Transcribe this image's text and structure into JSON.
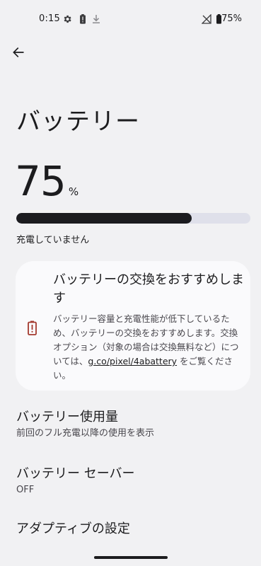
{
  "status_bar": {
    "time": "0:15",
    "battery_percent": "75%",
    "icons": [
      "gear-icon",
      "battery-alert-icon",
      "download-icon",
      "no-signal-icon",
      "battery-icon"
    ]
  },
  "header": {
    "back_icon": "arrow-back-icon",
    "title": "バッテリー"
  },
  "battery": {
    "level_value": "75",
    "level_unit": "%",
    "level_fraction": 0.75,
    "charging_status": "充電していません"
  },
  "warning_card": {
    "icon": "battery-alert-icon",
    "icon_color": "#a3392e",
    "title": "バッテリーの交換をおすすめします",
    "body_prefix": "バッテリー容量と充電性能が低下しているため、バッテリーの交換をおすすめします。交換オプション（対象の場合は交換無料など）については、",
    "link_text": "g.co/pixel/4abattery",
    "body_suffix": " をご覧ください。"
  },
  "settings": [
    {
      "title": "バッテリー使用量",
      "subtitle": "前回のフル充電以降の使用を表示"
    },
    {
      "title": "バッテリー セーバー",
      "subtitle": "OFF"
    },
    {
      "title": "アダプティブの設定",
      "subtitle": ""
    }
  ],
  "colors": {
    "background": "#f1f1f3",
    "progress_fill": "#1b1b1f",
    "progress_track": "#dfe0ea",
    "card_background": "#fafafc"
  }
}
